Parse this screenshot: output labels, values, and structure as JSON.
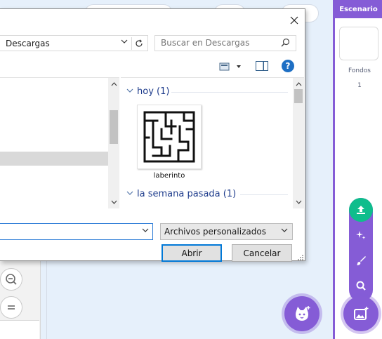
{
  "dialog": {
    "path": "Descargas",
    "search_placeholder": "Buscar en Descargas",
    "groups": [
      {
        "label": "hoy (1)"
      },
      {
        "label": "la semana pasada (1)"
      }
    ],
    "file": {
      "name": "laberinto"
    },
    "filename_value": "",
    "filetype": "Archivos personalizados",
    "open_label": "Abrir",
    "cancel_label": "Cancelar"
  },
  "stage": {
    "header": "Escenario",
    "backdrops_label": "Fondos",
    "backdrops_count": "1"
  },
  "colors": {
    "accent": "#855cd6",
    "upload": "#0fbd8c",
    "link_blue": "#1e3c8c",
    "focus_blue": "#0078d7"
  },
  "icons": [
    "close-icon",
    "chevron-down-icon",
    "refresh-icon",
    "search-icon",
    "view-options-icon",
    "preview-pane-icon",
    "help-icon",
    "zoom-out-icon",
    "zoom-reset-icon",
    "sprite-icon",
    "upload-icon",
    "surprise-icon",
    "paint-icon",
    "search-backdrop-icon",
    "backdrop-icon"
  ]
}
